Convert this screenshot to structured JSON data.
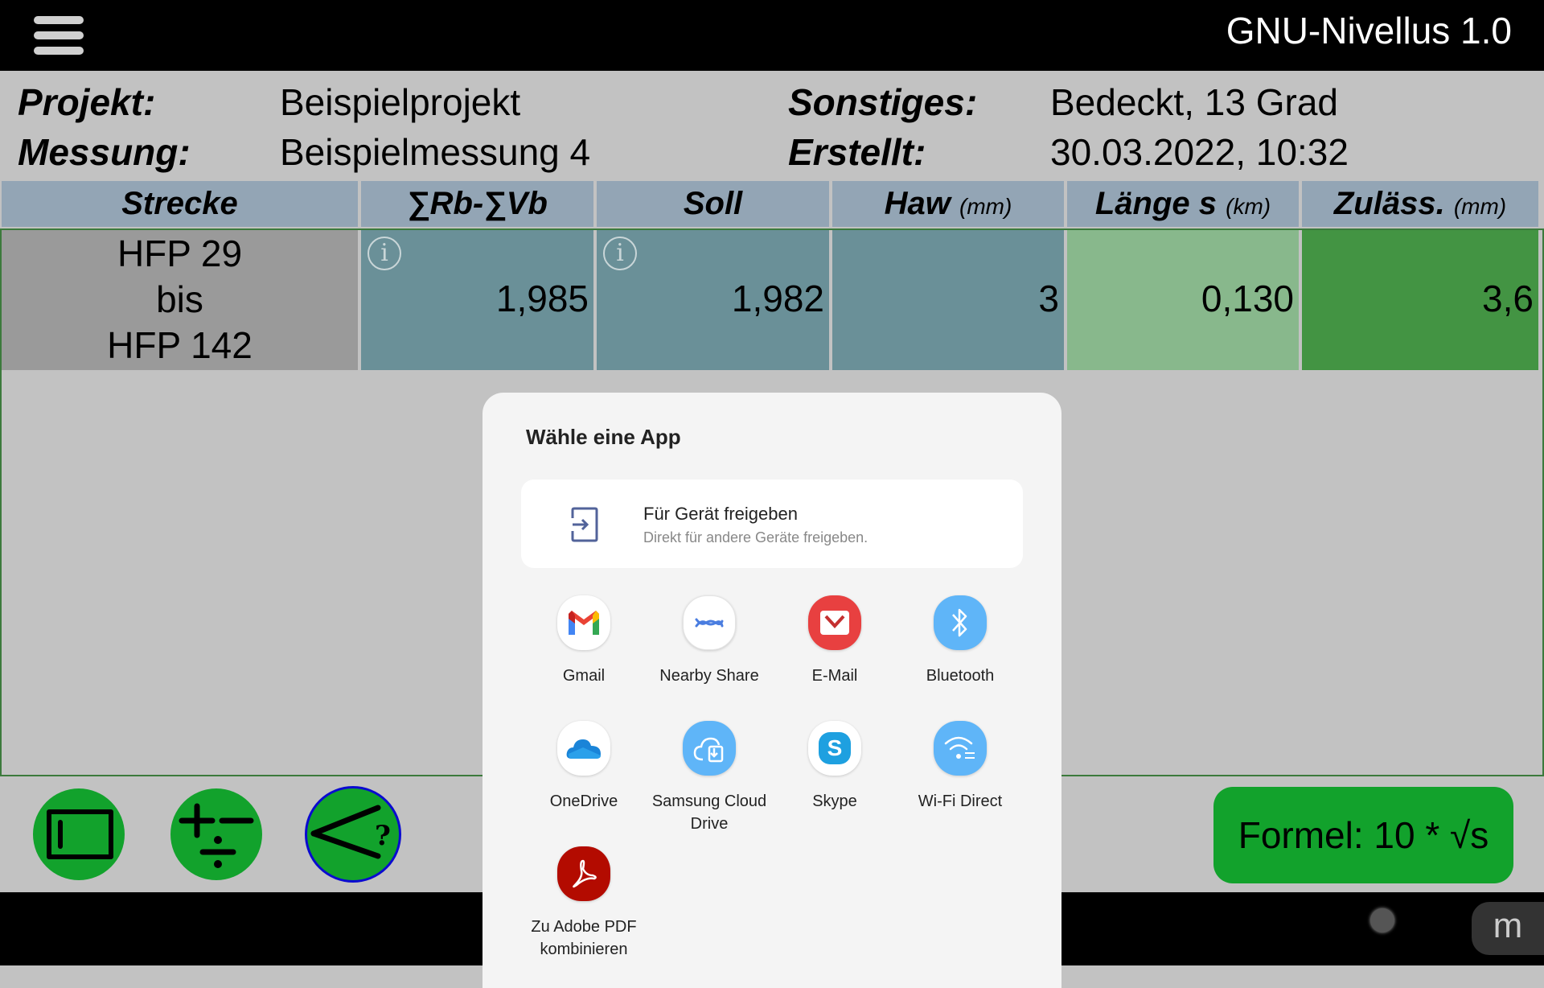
{
  "app": {
    "title": "GNU-Nivellus 1.0",
    "menu_icon": "hamburger-menu-icon"
  },
  "info": {
    "projekt_label": "Projekt:",
    "projekt_value": "Beispielprojekt",
    "messung_label": "Messung:",
    "messung_value": "Beispielmessung 4",
    "sonstiges_label": "Sonstiges:",
    "sonstiges_value": "Bedeckt, 13 Grad",
    "erstellt_label": "Erstellt:",
    "erstellt_value": "30.03.2022, 10:32"
  },
  "table": {
    "columns": [
      {
        "label": "Strecke",
        "unit": ""
      },
      {
        "label": "∑Rb-∑Vb",
        "unit": ""
      },
      {
        "label": "Soll",
        "unit": ""
      },
      {
        "label": "Haw",
        "unit": "(mm)"
      },
      {
        "label": "Länge s",
        "unit": "(km)"
      },
      {
        "label": "Zuläss.",
        "unit": "(mm)"
      }
    ],
    "rows": [
      {
        "strecke_from": "HFP 29",
        "strecke_sep": "bis",
        "strecke_to": "HFP 142",
        "rb_vb": "1,985",
        "soll": "1,982",
        "haw": "3",
        "laenge": "0,130",
        "zulaess": "3,6"
      }
    ],
    "colors": {
      "header": "#93a5b5",
      "strecke": "#9a9a9a",
      "value": "#6a9098",
      "laenge": "#88b88c",
      "zulaess": "#439443"
    }
  },
  "toolbar": {
    "buttons": [
      {
        "icon": "rectangle-view-icon"
      },
      {
        "icon": "plus-minus-divide-icon"
      },
      {
        "icon": "angle-question-icon"
      }
    ],
    "formel_label": "Formel: 10 * √s",
    "accent": "#12a22c"
  },
  "share_dialog": {
    "title": "Wähle eine App",
    "device_share": {
      "title": "Für Gerät freigeben",
      "subtitle": "Direkt für andere Geräte freigeben."
    },
    "apps": [
      {
        "label": "Gmail",
        "icon": "gmail-icon"
      },
      {
        "label": "Nearby Share",
        "icon": "nearby-share-icon"
      },
      {
        "label": "E-Mail",
        "icon": "email-icon"
      },
      {
        "label": "Bluetooth",
        "icon": "bluetooth-icon"
      },
      {
        "label": "OneDrive",
        "icon": "onedrive-icon"
      },
      {
        "label": "Samsung Cloud Drive",
        "icon": "samsung-cloud-icon"
      },
      {
        "label": "Skype",
        "icon": "skype-icon"
      },
      {
        "label": "Wi-Fi Direct",
        "icon": "wifi-direct-icon"
      },
      {
        "label": "Zu Adobe PDF kombinieren",
        "icon": "adobe-pdf-icon"
      }
    ]
  },
  "navbar": {
    "keyboard_label": "m"
  }
}
